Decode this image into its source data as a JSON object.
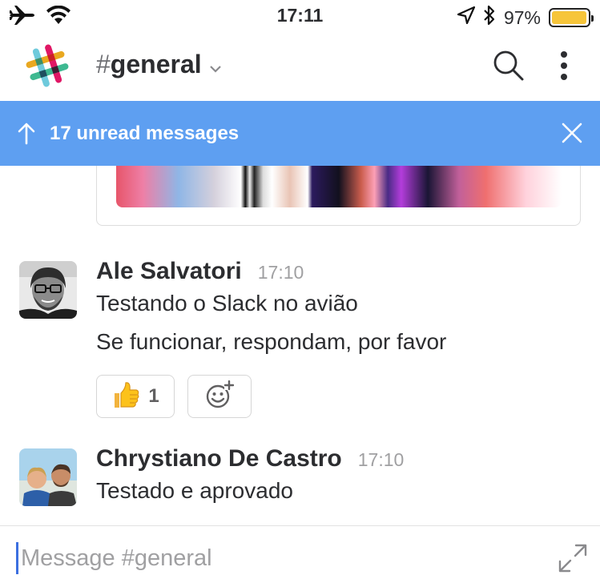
{
  "status_bar": {
    "time": "17:11",
    "battery_text": "97%",
    "battery_level": 0.97,
    "icons": [
      "airplane-icon",
      "wifi-icon",
      "location-icon",
      "bluetooth-icon",
      "battery-icon"
    ]
  },
  "header": {
    "channel_hash": "#",
    "channel_name": "general",
    "icons": [
      "slack-logo",
      "chevron-down-icon",
      "search-icon",
      "more-vertical-icon"
    ]
  },
  "banner": {
    "text": "17 unread messages",
    "color": "#5e9ff1",
    "icons": [
      "arrow-up-icon",
      "close-icon"
    ]
  },
  "messages": [
    {
      "author": "Ale Salvatori",
      "time": "17:10",
      "lines": [
        "Testando o Slack no avião",
        "Se funcionar, respondam, por favor"
      ],
      "reactions": [
        {
          "emoji": "thumbs-up-icon",
          "count": "1"
        }
      ],
      "add_reaction_icon": "add-reaction-icon"
    },
    {
      "author": "Chrystiano De Castro",
      "time": "17:10",
      "lines": [
        "Testado e aprovado"
      ]
    }
  ],
  "composer": {
    "placeholder": "Message #general",
    "value": "",
    "icon": "expand-icon"
  },
  "colors": {
    "accent_blue": "#5e9ff1",
    "battery_yellow": "#f6c53a",
    "text_dark": "#2c2d30",
    "text_muted": "#a0a0a2"
  }
}
